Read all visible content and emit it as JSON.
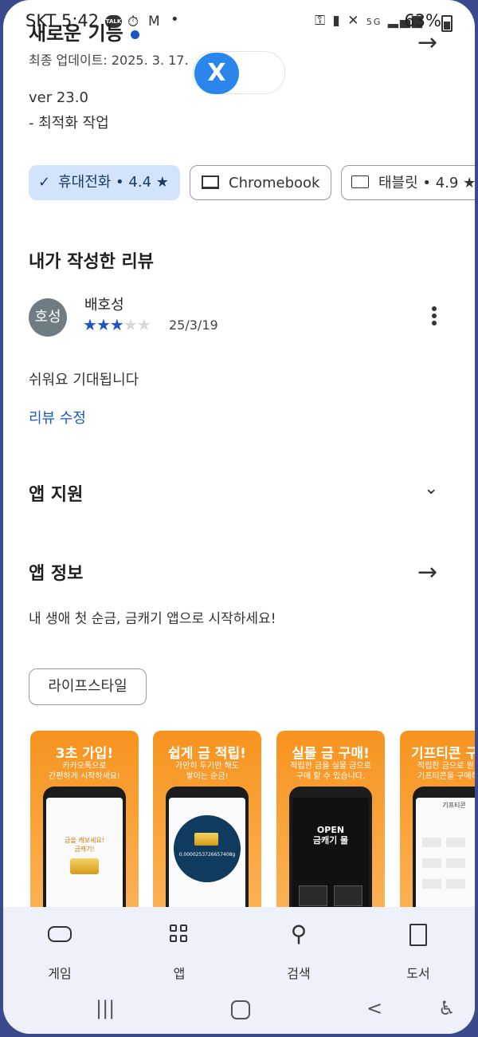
{
  "status_bar": {
    "carrier_time": "SKT 5:42",
    "talk_badge": "TALK",
    "network": "5G",
    "battery": "63%"
  },
  "header": {
    "title_partial": "새로운 기능",
    "updated": "최종 업데이트: 2025. 3. 17.",
    "x_label": "X"
  },
  "whats_new": {
    "version": "ver 23.0",
    "note": "- 최적화 작업"
  },
  "device_chips": [
    {
      "label": "휴대전화 • 4.4 ★",
      "selected": true,
      "icon": "check-icon"
    },
    {
      "label": "Chromebook",
      "selected": false,
      "icon": "laptop-icon"
    },
    {
      "label": "태블릿 • 4.9 ★",
      "selected": false,
      "icon": "tablet-icon"
    }
  ],
  "my_review": {
    "section_title": "내가 작성한 리뷰",
    "avatar_text": "호성",
    "author": "배호성",
    "rating": 3,
    "rating_max": 5,
    "date": "25/3/19",
    "text": "쉬워요 기대됩니다",
    "edit_label": "리뷰 수정"
  },
  "app_support": {
    "title": "앱 지원"
  },
  "app_info": {
    "title": "앱 정보",
    "description": "내 생애 첫 순금, 금캐기 앱으로 시작하세요!",
    "tag": "라이프스타일"
  },
  "screenshots": [
    {
      "headline": "3초 가입!",
      "sub": "카카오톡으로\n간편하게 시작하세요!",
      "inner": "금을 캐보세요!\n금캐기!"
    },
    {
      "headline": "쉽게 금 적립!",
      "sub": "가만히 두기만 해도\n쌓이는 순금!",
      "inner": "0.0000253726657408g"
    },
    {
      "headline": "실물 금 구매!",
      "sub": "적립한 금을 실물 금으로\n구매 할 수 있습니다.",
      "inner": "OPEN\n금캐기 몰"
    },
    {
      "headline": "기프티콘 구",
      "sub": "적립한 금으로 원\n기프티콘을 구매하",
      "inner": "기프티콘"
    }
  ],
  "bottom_nav": [
    {
      "label": "게임",
      "icon": "gamepad-icon"
    },
    {
      "label": "앱",
      "icon": "apps-grid-icon"
    },
    {
      "label": "검색",
      "icon": "search-icon"
    },
    {
      "label": "도서",
      "icon": "book-icon"
    }
  ],
  "colors": {
    "accent": "#1a56c4",
    "chip_selected_bg": "#d3e3fb",
    "nav_bg": "#eef1fa",
    "frame": "#3a4a8c"
  }
}
